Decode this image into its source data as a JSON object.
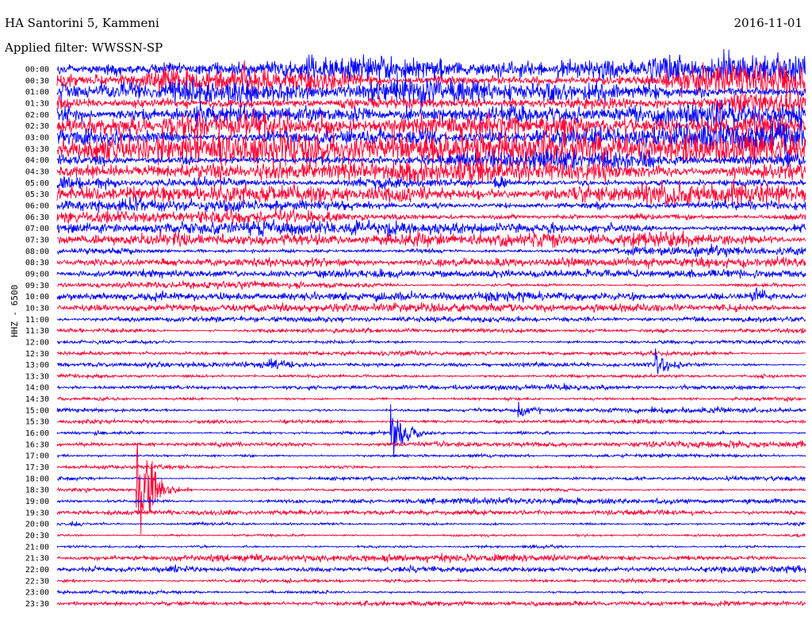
{
  "header": {
    "station": "HA Santorini 5, Kammeni",
    "date": "2016-11-01",
    "filter": "Applied filter: WWSSN-SP",
    "channel": "HHZ - 6500"
  },
  "chart_data": {
    "type": "line",
    "title": "HA Santorini 5, Kammeni",
    "date": "2016-11-01",
    "filter": "WWSSN-SP",
    "ylabel": "HHZ - 6500",
    "row_labels": [
      "00:00",
      "00:30",
      "01:00",
      "01:30",
      "02:00",
      "02:30",
      "03:00",
      "03:30",
      "04:00",
      "04:30",
      "05:00",
      "05:30",
      "06:00",
      "06:30",
      "07:00",
      "07:30",
      "08:00",
      "08:30",
      "09:00",
      "09:30",
      "10:00",
      "10:30",
      "11:00",
      "11:30",
      "12:00",
      "12:30",
      "13:00",
      "13:30",
      "14:00",
      "14:30",
      "15:00",
      "15:30",
      "16:00",
      "16:30",
      "17:00",
      "17:30",
      "18:00",
      "18:30",
      "19:00",
      "19:30",
      "20:00",
      "20:30",
      "21:00",
      "21:30",
      "22:00",
      "22:30",
      "23:00",
      "23:30"
    ],
    "series_colors": [
      "#0000ff",
      "#ff0033"
    ],
    "noise_level": [
      1.9,
      1.9,
      1.8,
      1.8,
      1.7,
      1.7,
      1.7,
      1.6,
      1.4,
      1.3,
      1.2,
      1.1,
      0.95,
      0.9,
      0.85,
      0.8,
      0.55,
      0.45,
      0.42,
      0.42,
      0.48,
      0.42,
      0.35,
      0.35,
      0.35,
      0.35,
      0.35,
      0.35,
      0.35,
      0.35,
      0.35,
      0.35,
      0.35,
      0.35,
      0.35,
      0.35,
      0.35,
      0.35,
      0.35,
      0.35,
      0.35,
      0.35,
      0.35,
      0.35,
      0.35,
      0.35,
      0.35,
      0.35
    ],
    "events": [
      {
        "row": 32,
        "minute": 13.4,
        "amplitude": 25
      },
      {
        "row": 37,
        "minute": 3.2,
        "amplitude": 60
      },
      {
        "row": 26,
        "minute": 24.0,
        "amplitude": 12
      },
      {
        "row": 26,
        "minute": 8.5,
        "amplitude": 8
      },
      {
        "row": 30,
        "minute": 18.5,
        "amplitude": 8
      },
      {
        "row": 20,
        "minute": 27.8,
        "amplitude": 9
      },
      {
        "row": 10,
        "minute": 17.5,
        "amplitude": 8
      }
    ]
  }
}
